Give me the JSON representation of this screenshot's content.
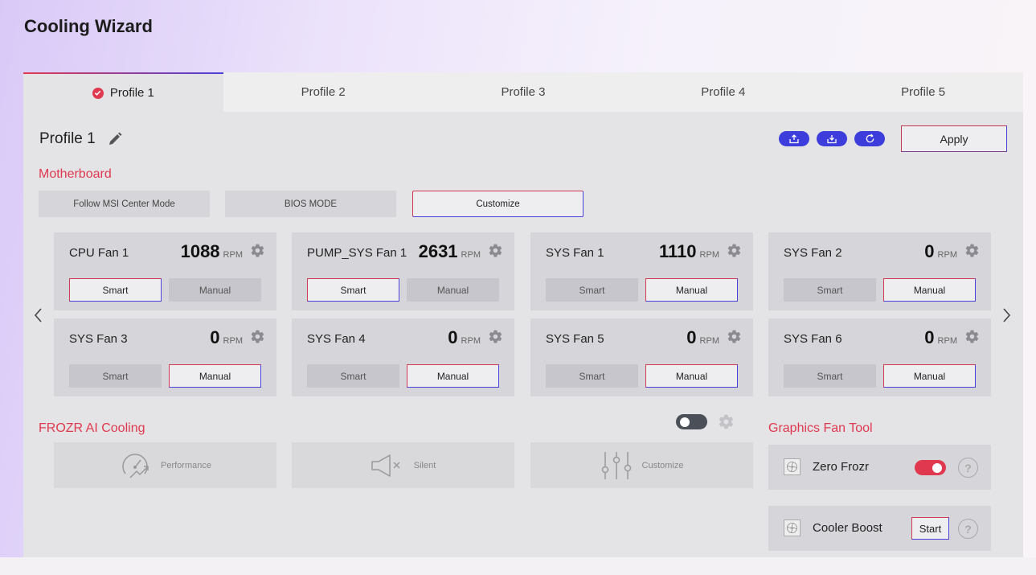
{
  "app": {
    "title": "Cooling Wizard"
  },
  "tabs": [
    {
      "label": "Profile 1",
      "active": true
    },
    {
      "label": "Profile 2",
      "active": false
    },
    {
      "label": "Profile 3",
      "active": false
    },
    {
      "label": "Profile 4",
      "active": false
    },
    {
      "label": "Profile 5",
      "active": false
    }
  ],
  "profile": {
    "name": "Profile 1",
    "apply_label": "Apply"
  },
  "motherboard": {
    "title": "Motherboard",
    "modes": [
      "Follow MSI Center Mode",
      "BIOS MODE",
      "Customize"
    ],
    "active_mode": "Customize"
  },
  "fans": [
    {
      "name": "CPU Fan 1",
      "rpm": "1088",
      "unit": "RPM",
      "mode": "Smart"
    },
    {
      "name": "PUMP_SYS Fan 1",
      "rpm": "2631",
      "unit": "RPM",
      "mode": "Smart"
    },
    {
      "name": "SYS Fan 1",
      "rpm": "1110",
      "unit": "RPM",
      "mode": "Manual"
    },
    {
      "name": "SYS Fan 2",
      "rpm": "0",
      "unit": "RPM",
      "mode": "Manual"
    },
    {
      "name": "SYS Fan 3",
      "rpm": "0",
      "unit": "RPM",
      "mode": "Manual"
    },
    {
      "name": "SYS Fan 4",
      "rpm": "0",
      "unit": "RPM",
      "mode": "Manual"
    },
    {
      "name": "SYS Fan 5",
      "rpm": "0",
      "unit": "RPM",
      "mode": "Manual"
    },
    {
      "name": "SYS Fan 6",
      "rpm": "0",
      "unit": "RPM",
      "mode": "Manual"
    }
  ],
  "fan_buttons": {
    "smart": "Smart",
    "manual": "Manual"
  },
  "ai_cooling": {
    "title": "FROZR AI Cooling",
    "enabled": false,
    "modes": [
      {
        "label": "Performance",
        "icon": "speedometer-icon"
      },
      {
        "label": "Silent",
        "icon": "speaker-mute-icon"
      },
      {
        "label": "Customize",
        "icon": "sliders-icon"
      }
    ]
  },
  "graphics": {
    "title": "Graphics Fan Tool",
    "zero_frozr": {
      "label": "Zero Frozr",
      "enabled": true
    },
    "cooler_boost": {
      "label": "Cooler Boost",
      "button": "Start"
    },
    "help": "?"
  },
  "colors": {
    "accent_red": "#e0394f",
    "accent_blue": "#3d3ddb",
    "toggle_off": "#4a4f58"
  }
}
